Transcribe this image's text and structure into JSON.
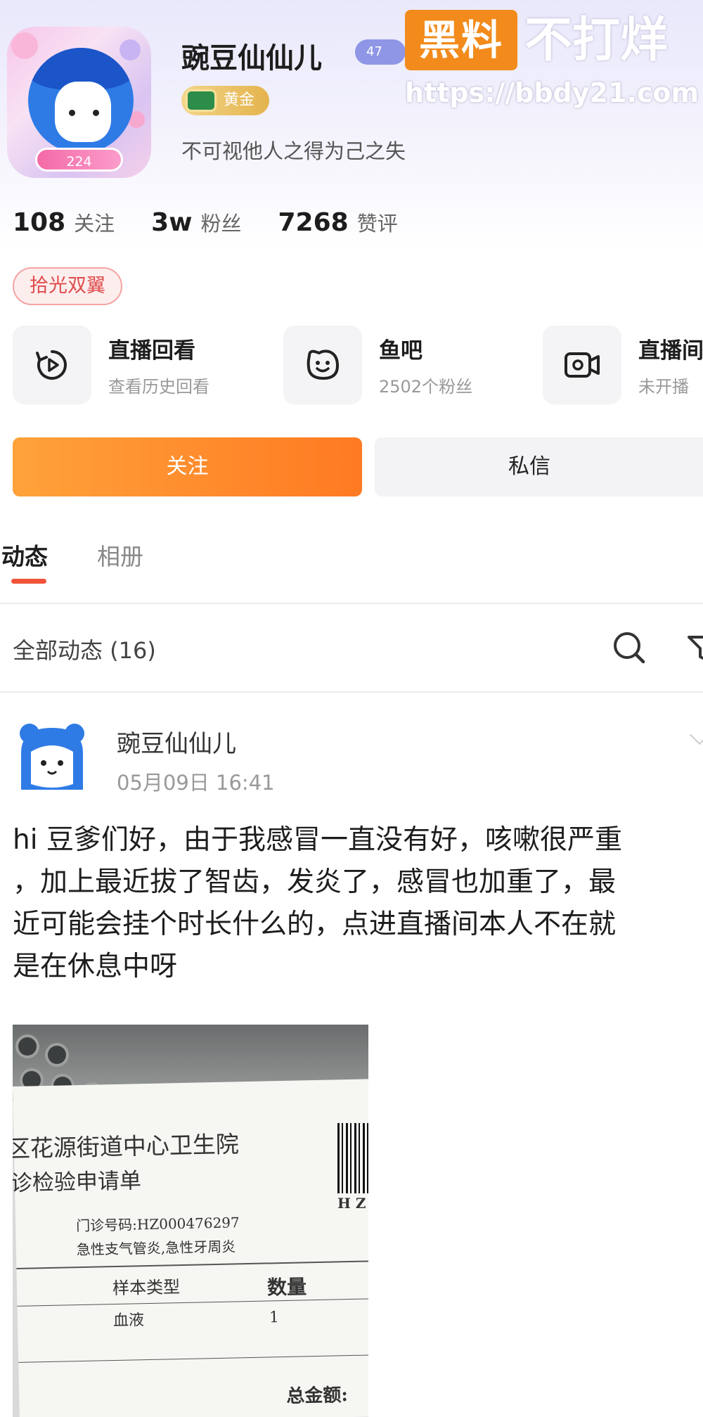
{
  "profile": {
    "username": "豌豆仙仙儿",
    "level_badge": "47",
    "frame_level": "224",
    "rank_badge": "黄金",
    "signature": "不可视他人之得为己之失"
  },
  "watermark": {
    "box_text": "黑料",
    "text": "不打烊",
    "url": "https://bbdy21.com"
  },
  "stats": [
    {
      "value": "108",
      "label": "关注"
    },
    {
      "value": "3w",
      "label": "粉丝"
    },
    {
      "value": "7268",
      "label": "赞评"
    }
  ],
  "tag": "拾光双翼",
  "features": [
    {
      "title": "直播回看",
      "subtitle": "查看历史回看",
      "icon": "replay-icon"
    },
    {
      "title": "鱼吧",
      "subtitle": "2502个粉丝",
      "icon": "fish-bar-icon"
    },
    {
      "title": "直播间",
      "subtitle": "未开播",
      "icon": "camera-icon"
    }
  ],
  "actions": {
    "follow": "关注",
    "message": "私信"
  },
  "tabs": [
    {
      "label": "动态",
      "active": true
    },
    {
      "label": "相册",
      "active": false
    }
  ],
  "filter": {
    "label": "全部动态 (16)"
  },
  "post": {
    "author": "豌豆仙仙儿",
    "time": "05月09日 16:41",
    "lines": [
      "hi 豆爹们好，由于我感冒一直没有好，咳嗽很严重",
      "，加上最近拔了智齿，发炎了，感冒也加重了，最",
      "近可能会挂个时长什么的，点进直播间本人不在就",
      "是在休息中呀"
    ],
    "image_text": {
      "hospital": "区花源街道中心卫生院",
      "form": "诊检验申请单",
      "clinic_no": "门诊号码:HZ000476297",
      "diagnosis": "急性支气管炎,急性牙周炎",
      "col1": "样本类型",
      "col2": "数量",
      "sample": "血液",
      "qty": "1",
      "total": "总金额:",
      "bar_text": "H Z"
    }
  },
  "colors": {
    "accent_orange": "#ff8a2a",
    "tab_underline": "#f0533a",
    "gold": "#e4b34c"
  }
}
